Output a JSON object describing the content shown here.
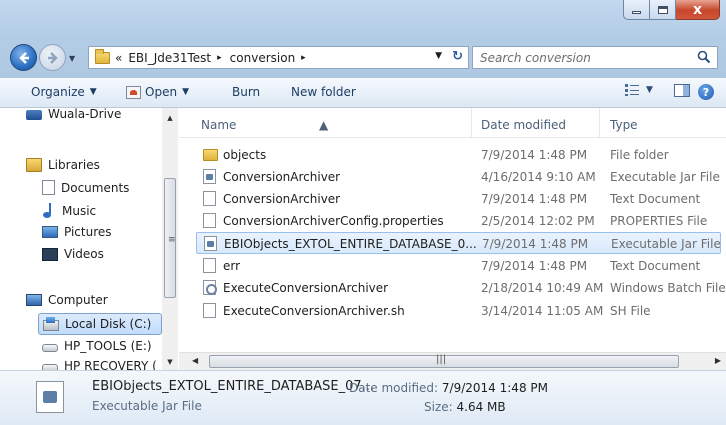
{
  "window": {
    "controls": {
      "minimize": "–",
      "maximize": "□",
      "close": "x"
    }
  },
  "address": {
    "overflow": "«",
    "crumbs": [
      "EBI_Jde31Test",
      "conversion"
    ],
    "separator": "▸"
  },
  "search": {
    "placeholder": "Search conversion"
  },
  "toolbar": {
    "organize": "Organize",
    "open": "Open",
    "burn": "Burn",
    "new_folder": "New folder"
  },
  "nav": [
    {
      "label": "Wuala-Drive",
      "icon": "network-drive-icon"
    },
    {
      "label": "Libraries",
      "icon": "libraries-icon"
    },
    {
      "label": "Documents",
      "icon": "documents-icon"
    },
    {
      "label": "Music",
      "icon": "music-icon"
    },
    {
      "label": "Pictures",
      "icon": "pictures-icon"
    },
    {
      "label": "Videos",
      "icon": "videos-icon"
    },
    {
      "label": "Computer",
      "icon": "computer-icon"
    },
    {
      "label": "Local Disk (C:)",
      "icon": "local-disk-icon"
    },
    {
      "label": "HP_TOOLS (E:)",
      "icon": "drive-icon"
    },
    {
      "label": "HP RECOVERY (",
      "icon": "drive-icon"
    }
  ],
  "columns": {
    "name": "Name",
    "date": "Date modified",
    "type": "Type"
  },
  "files": [
    {
      "name": "objects",
      "date": "7/9/2014 1:48 PM",
      "type": "File folder",
      "icon": "folder-icon"
    },
    {
      "name": "ConversionArchiver",
      "date": "4/16/2014 9:10 AM",
      "type": "Executable Jar File",
      "icon": "jar-file-icon"
    },
    {
      "name": "ConversionArchiver",
      "date": "7/9/2014 1:48 PM",
      "type": "Text Document",
      "icon": "text-file-icon"
    },
    {
      "name": "ConversionArchiverConfig.properties",
      "date": "2/5/2014 12:02 PM",
      "type": "PROPERTIES File",
      "icon": "text-file-icon"
    },
    {
      "name": "EBIObjects_EXTOL_ENTIRE_DATABASE_0...",
      "date": "7/9/2014 1:48 PM",
      "type": "Executable Jar File",
      "icon": "jar-file-icon"
    },
    {
      "name": "err",
      "date": "7/9/2014 1:48 PM",
      "type": "Text Document",
      "icon": "text-file-icon"
    },
    {
      "name": "ExecuteConversionArchiver",
      "date": "2/18/2014 10:49 AM",
      "type": "Windows Batch File",
      "icon": "batch-file-icon"
    },
    {
      "name": "ExecuteConversionArchiver.sh",
      "date": "3/14/2014 11:05 AM",
      "type": "SH File",
      "icon": "text-file-icon"
    }
  ],
  "selected_index": 4,
  "details": {
    "name": "EBIObjects_EXTOL_ENTIRE_DATABASE_07...",
    "type": "Executable Jar File",
    "modified_label": "Date modified:",
    "modified_value": "7/9/2014 1:48 PM",
    "size_label": "Size:",
    "size_value": "4.64 MB"
  },
  "colors": {
    "titlebar": "#c2d9ef",
    "selection": "#d7e9fc",
    "close": "#c6472b"
  }
}
